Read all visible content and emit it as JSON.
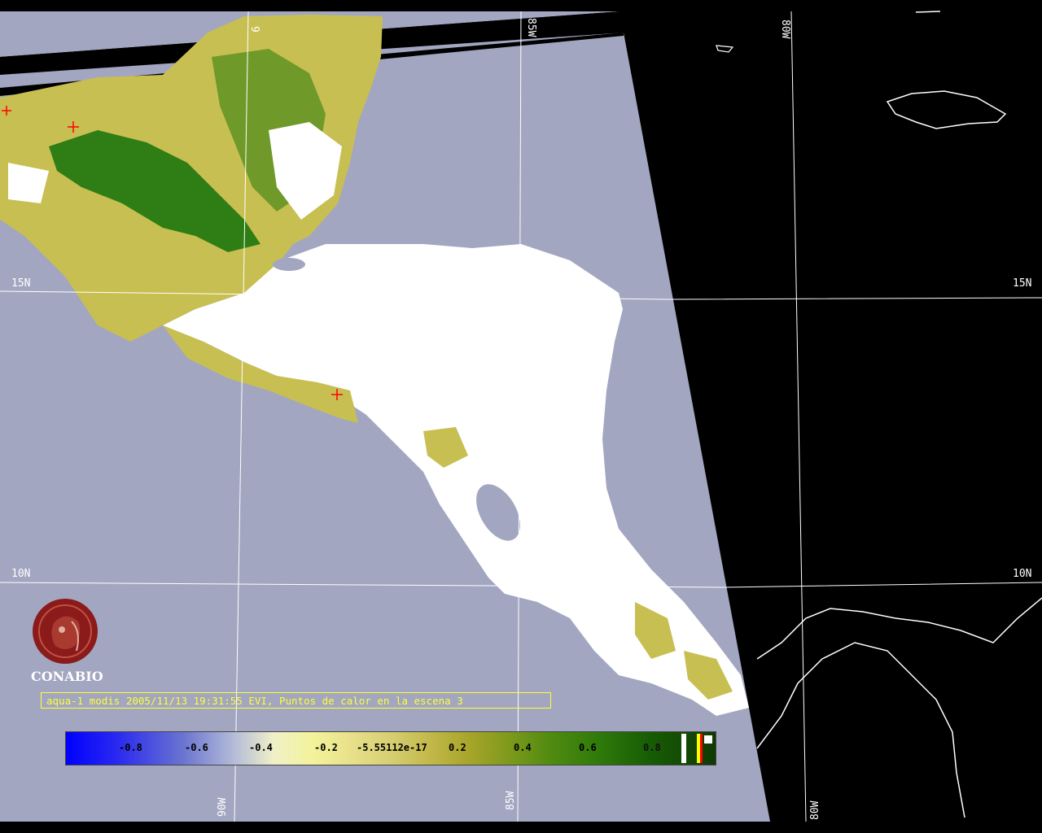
{
  "map": {
    "colors": {
      "ocean_in_swath": "#a2a6c0",
      "outside_swath": "#000000",
      "cloud": "#ffffff",
      "coastline": "#ffffff",
      "graticule": "#ffffff",
      "vegetation_dense": "#2e7d15",
      "vegetation_sparse": "#c8bf52",
      "hotspot_marker": "#ff0000"
    },
    "grid_labels": {
      "lat_15_left": "15N",
      "lat_15_right": "15N",
      "lat_10_left": "10N",
      "lat_10_right": "10N",
      "lon_90_top": "9",
      "lon_85_top": "85W",
      "lon_80_top": "80W",
      "lon_90_bottom": "90W",
      "lon_85_bottom": "85W",
      "lon_80_bottom": "80W"
    },
    "hotspot_count": 3
  },
  "logo": {
    "name": "CONABIO",
    "color": "#8b1a1a"
  },
  "caption": "aqua-1 modis 2005/11/13 19:31:55 EVI, Puntos de calor en la escena 3",
  "colorbar": {
    "ticks": [
      "-0.8",
      "-0.6",
      "-0.4",
      "-0.2",
      "-5.55112e-17",
      "0.2",
      "0.4",
      "0.6",
      "0.8"
    ],
    "end_swatches": [
      "#ffffff",
      "#ffff00",
      "#ff0000"
    ]
  }
}
